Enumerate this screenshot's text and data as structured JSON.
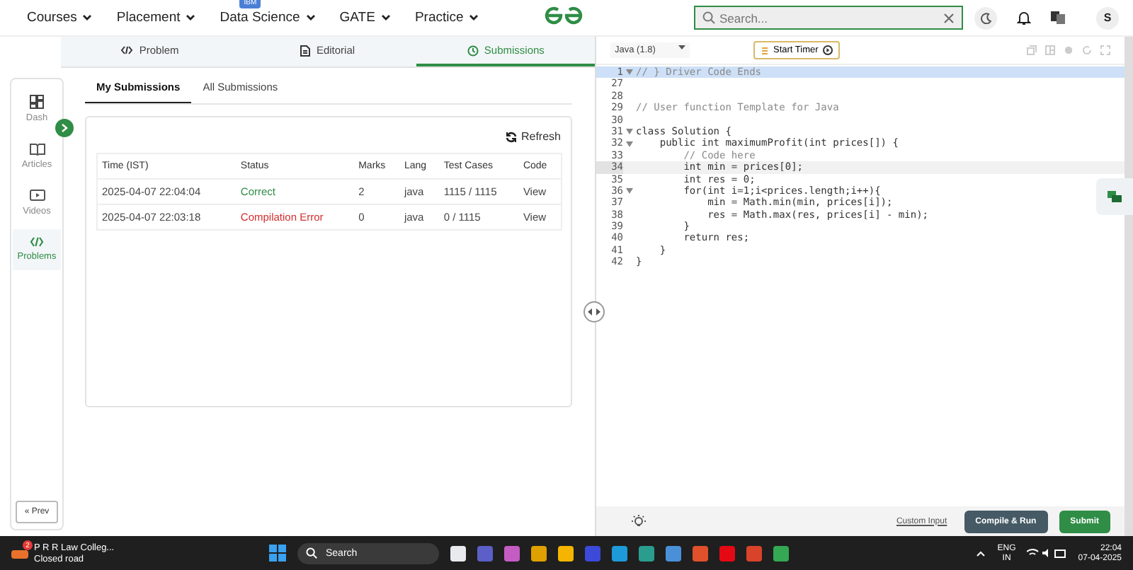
{
  "nav": {
    "items": [
      {
        "label": "Courses"
      },
      {
        "label": "Placement"
      },
      {
        "label": "Data Science",
        "badge": "IBM"
      },
      {
        "label": "GATE"
      },
      {
        "label": "Practice"
      }
    ],
    "search": {
      "placeholder": "Search..."
    },
    "avatar": "S"
  },
  "tabs": [
    {
      "label": "Problem",
      "selected": false
    },
    {
      "label": "Editorial",
      "selected": false
    },
    {
      "label": "Submissions",
      "selected": true
    }
  ],
  "sidebar": {
    "items": [
      {
        "label": "Dash",
        "selected": false
      },
      {
        "label": "Articles",
        "selected": false
      },
      {
        "label": "Videos",
        "selected": false
      },
      {
        "label": "Problems",
        "selected": true
      }
    ],
    "prev": "« Prev"
  },
  "subtabs": [
    {
      "label": "My Submissions",
      "selected": true
    },
    {
      "label": "All Submissions",
      "selected": false
    }
  ],
  "refresh": "Refresh",
  "table": {
    "columns": [
      "Time (IST)",
      "Status",
      "Marks",
      "Lang",
      "Test Cases",
      "Code"
    ],
    "rows": [
      {
        "time": "2025-04-07 22:04:04",
        "status": "Correct",
        "color": "#2f8d46",
        "marks": "2",
        "lang": "java",
        "test_cases": "1115 / 1115",
        "code": "View"
      },
      {
        "time": "2025-04-07 22:03:18",
        "status": "Compilation Error",
        "color": "#d32f2f",
        "marks": "0",
        "lang": "java",
        "test_cases": "0 / 1115",
        "code": "View"
      }
    ]
  },
  "editor": {
    "language": "Java (1.8)",
    "timer": "Start Timer",
    "lines": [
      {
        "number": "1",
        "text": "// } Driver Code Ends",
        "kind": "comment",
        "selected": true,
        "current": false,
        "foldable": true
      },
      {
        "number": "27",
        "selected": false,
        "current": false,
        "foldable": false
      },
      {
        "number": "28",
        "selected": false,
        "current": false,
        "foldable": false
      },
      {
        "number": "29",
        "text": "// User function Template for Java",
        "kind": "comment",
        "selected": false,
        "current": false,
        "foldable": false
      },
      {
        "number": "30",
        "selected": false,
        "current": false,
        "foldable": false
      },
      {
        "number": "31",
        "text": "class Solution {",
        "kind": "code",
        "selected": false,
        "current": false,
        "foldable": true
      },
      {
        "number": "32",
        "text": "    public int maximumProfit(int prices[]) {",
        "kind": "code",
        "selected": false,
        "current": false,
        "foldable": true
      },
      {
        "number": "33",
        "text": "        // Code here",
        "kind": "comment",
        "selected": false,
        "current": false,
        "foldable": false
      },
      {
        "number": "34",
        "text": "        int min = prices[0];",
        "kind": "code",
        "selected": false,
        "current": true,
        "foldable": false
      },
      {
        "number": "35",
        "text": "        int res = 0;",
        "kind": "code",
        "selected": false,
        "current": false,
        "foldable": false
      },
      {
        "number": "36",
        "text": "        for(int i=1;i<prices.length;i++){",
        "kind": "code",
        "selected": false,
        "current": false,
        "foldable": true
      },
      {
        "number": "37",
        "text": "            min = Math.min(min, prices[i]);",
        "kind": "code",
        "selected": false,
        "current": false,
        "foldable": false
      },
      {
        "number": "38",
        "text": "            res = Math.max(res, prices[i] - min);",
        "kind": "code",
        "selected": false,
        "current": false,
        "foldable": false
      },
      {
        "number": "39",
        "text": "        }",
        "kind": "code",
        "selected": false,
        "current": false,
        "foldable": false
      },
      {
        "number": "40",
        "text": "        return res;",
        "kind": "code",
        "selected": false,
        "current": false,
        "foldable": false
      },
      {
        "number": "41",
        "text": "    }",
        "kind": "code",
        "selected": false,
        "current": false,
        "foldable": false
      },
      {
        "number": "42",
        "text": "}",
        "kind": "code",
        "selected": false,
        "current": false,
        "foldable": false
      }
    ],
    "custom_input": "Custom Input",
    "compile": "Compile & Run",
    "submit": "Submit"
  },
  "taskbar": {
    "weather_title": "P R R Law Colleg...",
    "weather_subtitle": "Closed road",
    "weather_badge": "2",
    "search": "Search",
    "lang_top": "ENG",
    "lang_bottom": "IN",
    "time": "22:04",
    "date": "07-04-2025"
  }
}
